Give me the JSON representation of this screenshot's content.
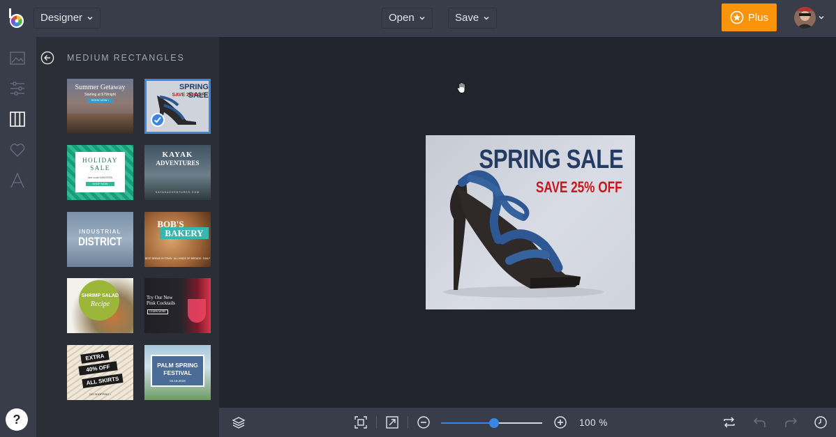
{
  "topbar": {
    "mode_label": "Designer",
    "open_label": "Open",
    "save_label": "Save",
    "plus_label": "Plus"
  },
  "rail": {
    "items": [
      "image-icon",
      "adjust-icon",
      "frames-icon",
      "heart-icon",
      "text-icon"
    ],
    "help_label": "?"
  },
  "panel": {
    "title": "MEDIUM RECTANGLES",
    "thumbs": {
      "t1": {
        "title": "Summer Getaway",
        "sub": "Starting at $79/night",
        "btn": "BOOK NOW ›"
      },
      "t2": {
        "title": "SPRING SALE",
        "sub": "SAVE 25% OFF"
      },
      "t3": {
        "title": "HOLIDAY",
        "title2": "SALE",
        "sub": "see code WINTER5",
        "btn": "SHOP NOW"
      },
      "t4": {
        "title": "KAYAK",
        "title2": "ADVENTURES",
        "sub": "KAYAKADVENTURES.COM"
      },
      "t5": {
        "title": "INDUSTRIAL",
        "title2": "DISTRICT"
      },
      "t6": {
        "title": "BOB'S",
        "title2": "BAKERY",
        "sub": "BEST BREAD IN TOWN · ALL KINDS OF BREADS · DAILY"
      },
      "t7": {
        "title": "SHRIMP SALAD",
        "title2": "Recipe"
      },
      "t8": {
        "title": "Try Our New",
        "title2": "Pink Cocktails",
        "btn": "LEARN MORE"
      },
      "t9": {
        "title": "EXTRA",
        "title2": "40% OFF",
        "title3": "ALL SKIRTS",
        "sub": "GO SHOPPING ›"
      },
      "t10": {
        "title": "PALM SPRING",
        "title2": "FESTIVAL",
        "sub": "04.16.2019"
      }
    }
  },
  "artboard": {
    "title": "SPRING SALE",
    "subtitle": "SAVE 25% OFF"
  },
  "bottombar": {
    "zoom_label": "100 %",
    "zoom_percent": 100
  },
  "colors": {
    "accent": "#3a86e0",
    "plus": "#f8930b",
    "topbar": "#393c49",
    "canvas": "#22252e"
  }
}
